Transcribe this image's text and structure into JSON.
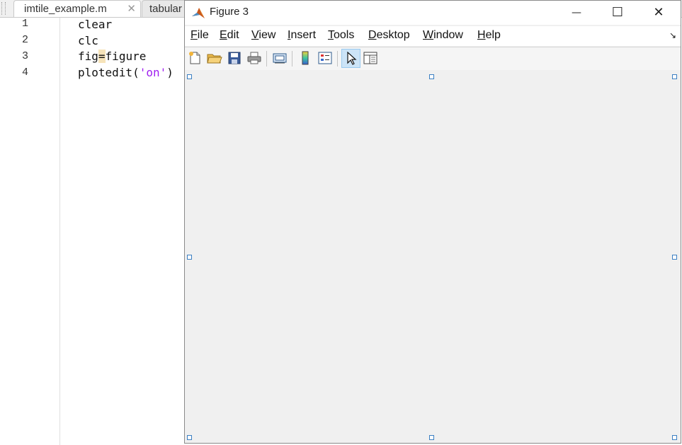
{
  "editor": {
    "tabs": [
      {
        "label": "imtile_example.m",
        "close_glyph": "✕"
      },
      {
        "label": "tabular"
      }
    ],
    "line_numbers": [
      "1",
      "2",
      "3",
      "4"
    ],
    "code": {
      "line1": "clear",
      "line2": "clc",
      "line3_a": "fig",
      "line3_b": "=",
      "line3_c": "figure",
      "line4_a": "plotedit(",
      "line4_b": "'on'",
      "line4_c": ")"
    }
  },
  "figure": {
    "title": "Figure 3",
    "window_buttons": {
      "minimize": "—",
      "maximize": "☐",
      "close": "✕"
    },
    "menu": [
      {
        "mnemonic": "F",
        "rest": "ile"
      },
      {
        "mnemonic": "E",
        "rest": "dit"
      },
      {
        "mnemonic": "V",
        "rest": "iew"
      },
      {
        "mnemonic": "I",
        "rest": "nsert"
      },
      {
        "mnemonic": "T",
        "rest": "ools"
      },
      {
        "mnemonic": "D",
        "rest": "esktop"
      },
      {
        "mnemonic": "W",
        "rest": "indow"
      },
      {
        "mnemonic": "H",
        "rest": "elp"
      }
    ],
    "toolbar_icons": [
      "new-figure-icon",
      "open-file-icon",
      "save-icon",
      "print-icon",
      "link-plot-icon",
      "colorbar-icon",
      "legend-icon",
      "edit-plot-icon",
      "property-inspector-icon"
    ],
    "edit_mode_active": true,
    "colors": {
      "accent": "#3b7fc2",
      "selected_tool_bg": "#cce4f7",
      "string": "#a020f0"
    }
  }
}
